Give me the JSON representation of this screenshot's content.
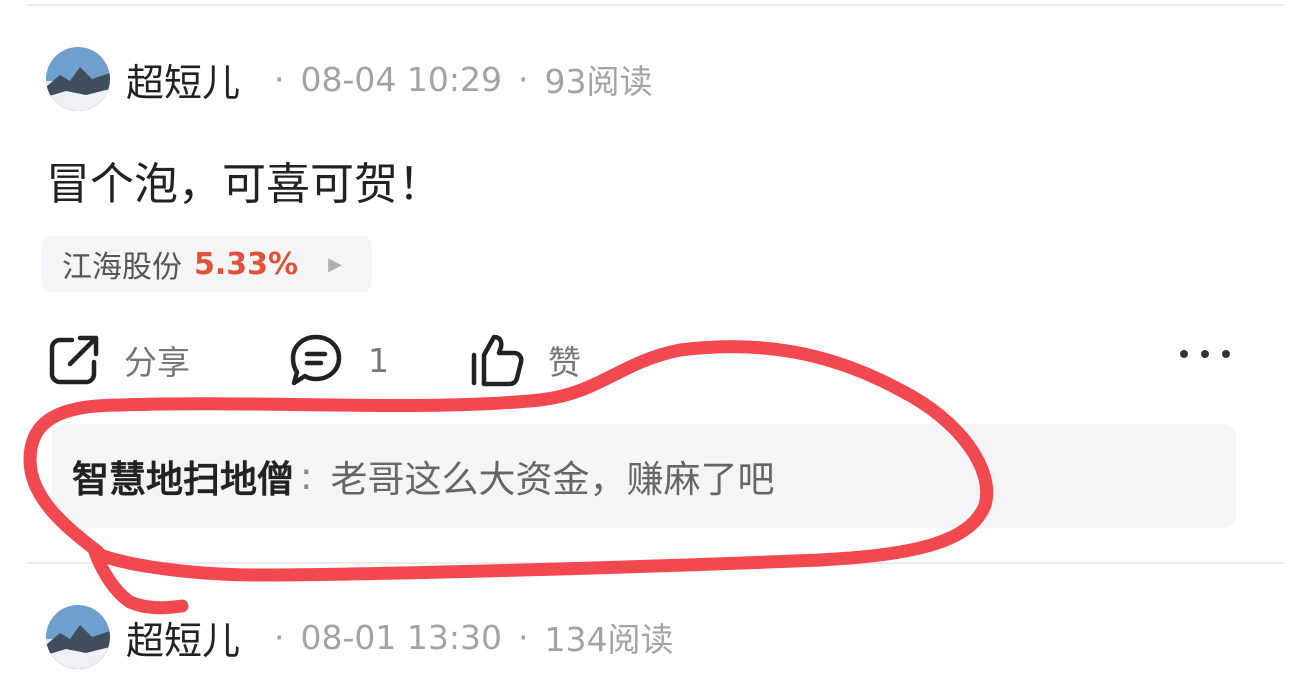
{
  "posts": [
    {
      "author": "超短儿",
      "date": "08-04 10:29",
      "reads": "93阅读",
      "content": "冒个泡，可喜可贺！",
      "stock": {
        "name": "江海股份",
        "change": "5.33%"
      },
      "actions": {
        "share": "分享",
        "comments": "1",
        "like": "赞"
      },
      "comment": {
        "author": "智慧地扫地僧",
        "separator": ":",
        "text": "老哥这么大资金，赚麻了吧"
      }
    },
    {
      "author": "超短儿",
      "date": "08-01 13:30",
      "reads": "134阅读"
    }
  ],
  "meta_separator": "·",
  "colors": {
    "accent_red": "#e0523a",
    "annotation_red": "#f2484f",
    "bubble_bg": "#f5f5f7"
  },
  "icons": [
    "share-icon",
    "comment-icon",
    "thumbs-up-icon",
    "more-icon",
    "arrow-right-icon"
  ]
}
